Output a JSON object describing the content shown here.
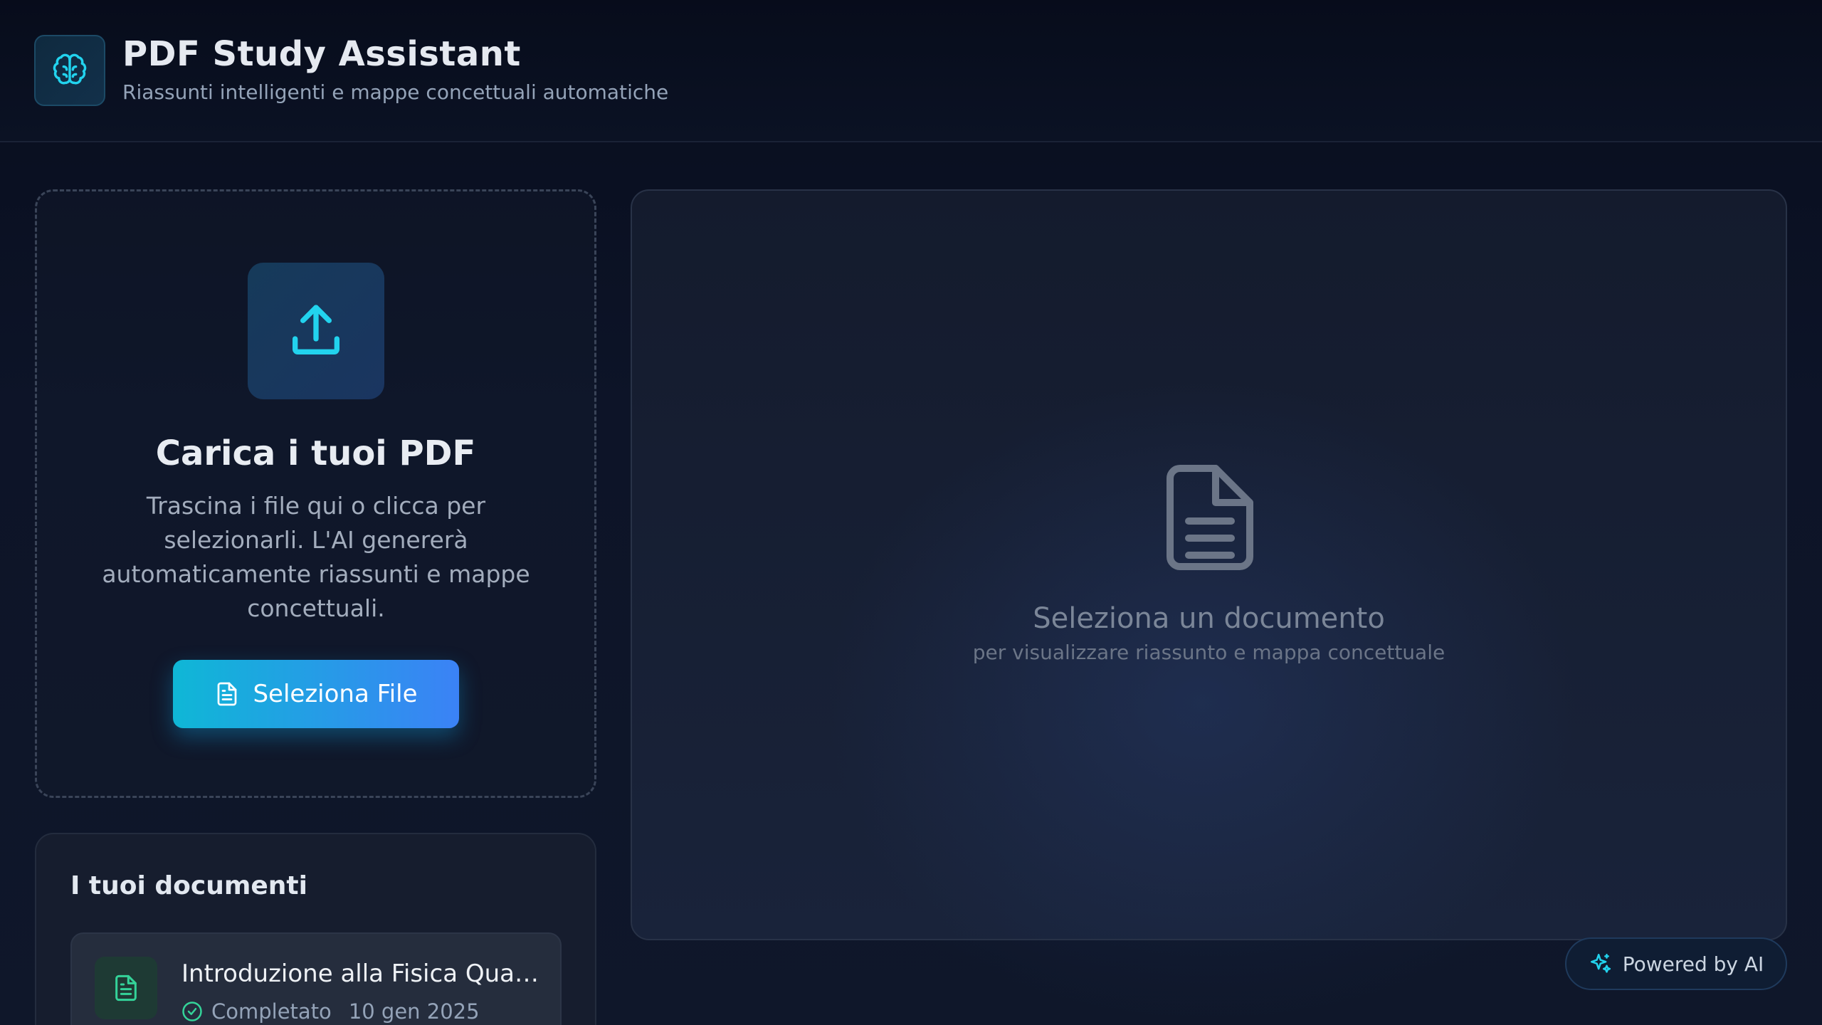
{
  "header": {
    "title": "PDF Study Assistant",
    "subtitle": "Riassunti intelligenti e mappe concettuali automatiche",
    "logo_icon": "brain-icon"
  },
  "upload": {
    "icon": "upload-icon",
    "title": "Carica i tuoi PDF",
    "description": "Trascina i file qui o clicca per selezionarli. L'AI genererà automaticamente riassunti e mappe concettuali.",
    "button_label": "Seleziona File",
    "button_icon": "file-icon"
  },
  "documents": {
    "title": "I tuoi documenti",
    "items": [
      {
        "name": "Introduzione alla Fisica Quantistica",
        "status": "Completato",
        "date": "10 gen 2025",
        "status_icon": "check-circle-icon"
      }
    ]
  },
  "viewer": {
    "empty_icon": "document-icon",
    "empty_title": "Seleziona un documento",
    "empty_subtitle": "per visualizzare riassunto e mappa concettuale"
  },
  "badge": {
    "label": "Powered by AI",
    "icon": "sparkles-icon"
  },
  "colors": {
    "accent_cyan": "#22d3ee",
    "accent_blue": "#3b82f6",
    "success_green": "#34d399",
    "background": "#0b1121"
  }
}
